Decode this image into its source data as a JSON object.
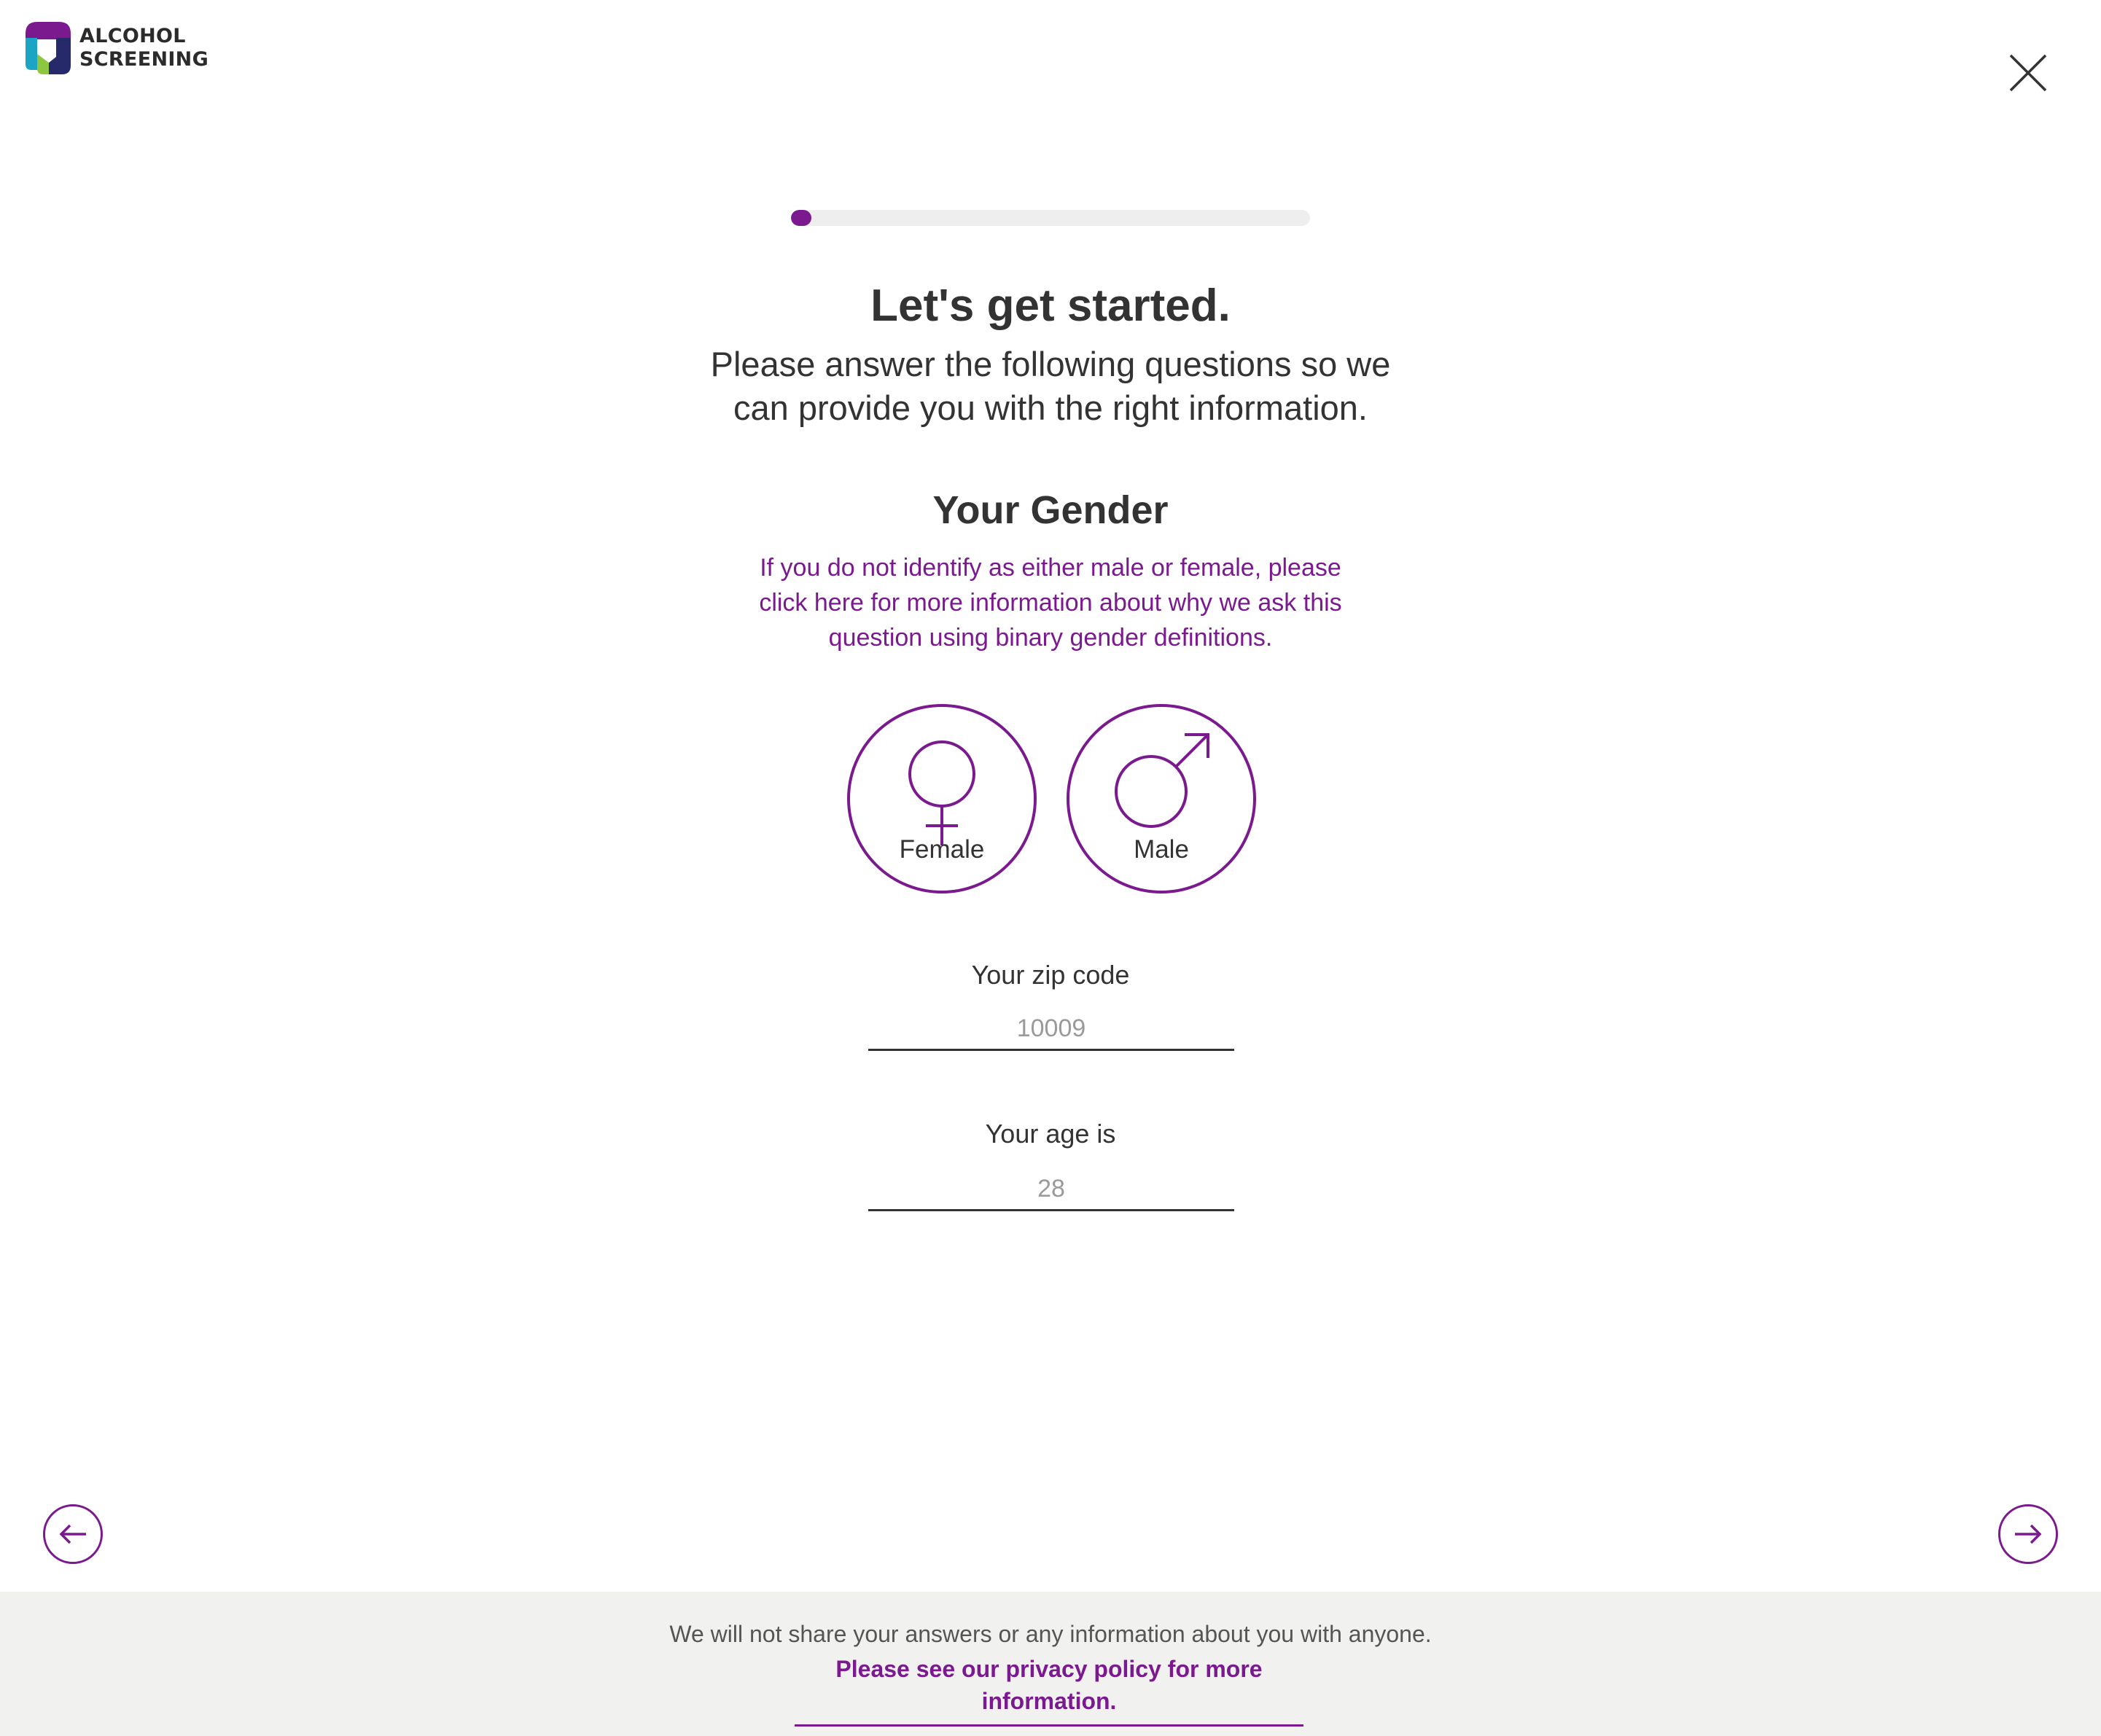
{
  "header": {
    "logo_line1": "ALCOHOL",
    "logo_line2": "SCREENING",
    "close_icon": "close-icon"
  },
  "progress": {
    "percent": 4,
    "color": "#7b1a8f"
  },
  "intro": {
    "title": "Let's get started.",
    "subtitle": "Please answer the following questions so we can provide you with the right information."
  },
  "gender": {
    "heading": "Your Gender",
    "info_link": "If you do not identify as either male or female, please click here for more information about why we ask this question using binary gender definitions.",
    "options": [
      {
        "label": "Female",
        "icon": "female-symbol-icon"
      },
      {
        "label": "Male",
        "icon": "male-symbol-icon"
      }
    ]
  },
  "zip": {
    "label": "Your zip code",
    "placeholder": "10009",
    "value": ""
  },
  "age": {
    "label": "Your age is",
    "placeholder": "28",
    "value": ""
  },
  "navigation": {
    "back_icon": "arrow-left-icon",
    "next_icon": "arrow-right-icon"
  },
  "footer": {
    "text": "We will not share your answers or any information about you with anyone.",
    "link": "Please see our privacy policy for more information."
  },
  "colors": {
    "accent": "#7b1a8f",
    "text": "#333333",
    "footer_bg": "#f1f1f0"
  }
}
